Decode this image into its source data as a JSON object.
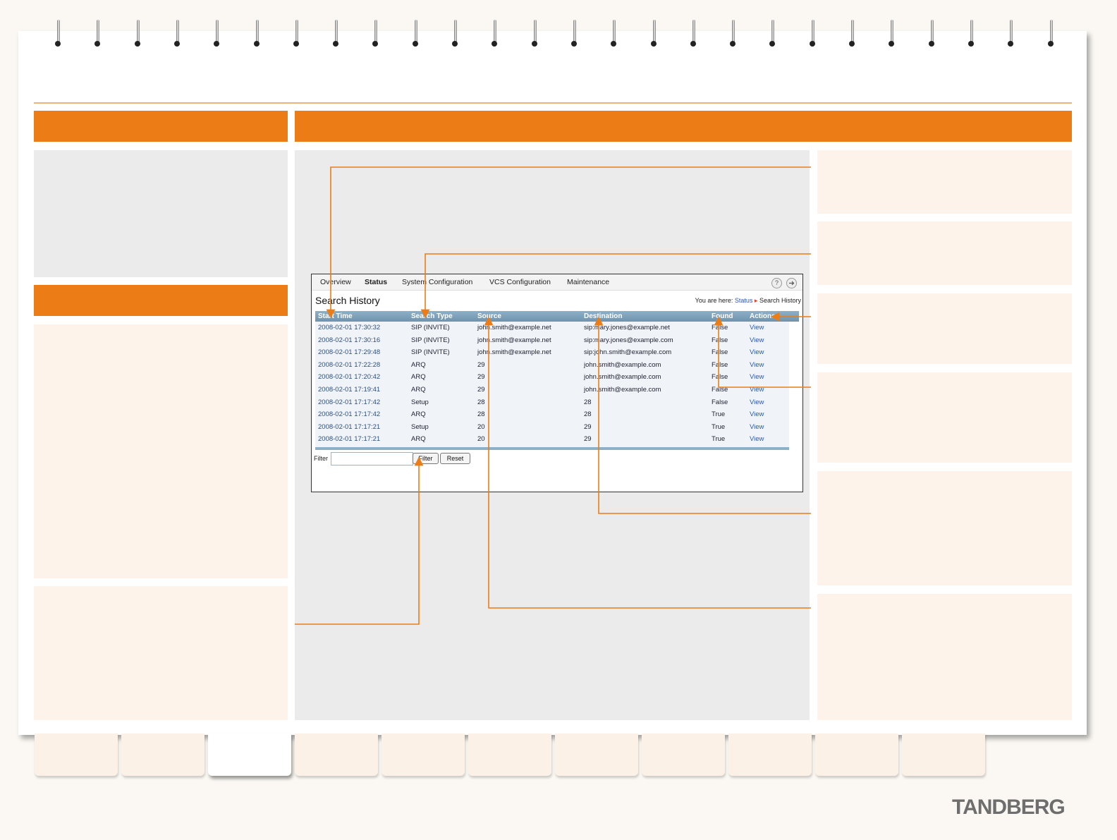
{
  "screen": {
    "nav": {
      "items": [
        "Overview",
        "Status",
        "System Configuration",
        "VCS Configuration",
        "Maintenance"
      ],
      "active": "Status",
      "help_icon": "?"
    },
    "page_title": "Search History",
    "breadcrumb": {
      "prefix": "You are here:",
      "link": "Status",
      "current": "Search History"
    },
    "table": {
      "columns": [
        "Start Time",
        "Search Type",
        "Source",
        "Destination",
        "Found",
        "Actions"
      ],
      "rows": [
        [
          "2008-02-01 17:30:32",
          "SIP (INVITE)",
          "john.smith@example.net",
          "sip:mary.jones@example.net",
          "False",
          "View"
        ],
        [
          "2008-02-01 17:30:16",
          "SIP (INVITE)",
          "john.smith@example.net",
          "sip:mary.jones@example.com",
          "False",
          "View"
        ],
        [
          "2008-02-01 17:29:48",
          "SIP (INVITE)",
          "john.smith@example.net",
          "sip:john.smith@example.com",
          "False",
          "View"
        ],
        [
          "2008-02-01 17:22:28",
          "ARQ",
          "29",
          "john.smith@example.com",
          "False",
          "View"
        ],
        [
          "2008-02-01 17:20:42",
          "ARQ",
          "29",
          "john.smith@example.com",
          "False",
          "View"
        ],
        [
          "2008-02-01 17:19:41",
          "ARQ",
          "29",
          "john.smith@example.com",
          "False",
          "View"
        ],
        [
          "2008-02-01 17:17:42",
          "Setup",
          "28",
          "28",
          "False",
          "View"
        ],
        [
          "2008-02-01 17:17:42",
          "ARQ",
          "28",
          "28",
          "True",
          "View"
        ],
        [
          "2008-02-01 17:17:21",
          "Setup",
          "20",
          "29",
          "True",
          "View"
        ],
        [
          "2008-02-01 17:17:21",
          "ARQ",
          "20",
          "29",
          "True",
          "View"
        ]
      ]
    },
    "filter": {
      "label": "Filter",
      "value": "",
      "filter_button": "Filter",
      "reset_button": "Reset"
    }
  },
  "brand": {
    "logo": "TANDBERG"
  },
  "colors": {
    "accent": "#ec7d16",
    "panel_grey": "#ebebec",
    "panel_cream": "#fdf3ea",
    "header_blue": "#7a9db6",
    "link": "#2b5aa8"
  }
}
